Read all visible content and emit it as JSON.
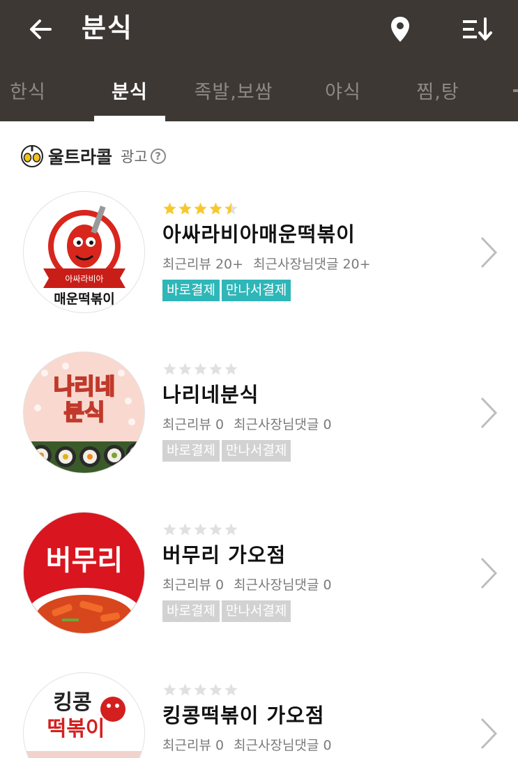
{
  "header": {
    "title": "분식",
    "tabs": [
      {
        "label": "한식",
        "active": false
      },
      {
        "label": "분식",
        "active": true
      },
      {
        "label": "족발,보쌈",
        "active": false
      },
      {
        "label": "야식",
        "active": false
      },
      {
        "label": "찜,탕",
        "active": false
      }
    ]
  },
  "ad_section": {
    "title": "울트라콜",
    "tag": "광고",
    "help": "?"
  },
  "restaurants": [
    {
      "name": "아싸라비아매운떡볶이",
      "rating": 4.5,
      "review_text": "최근리뷰 20+",
      "owner_reply_text": "최근사장님댓글 20+",
      "badges": [
        "바로결제",
        "만나서결제"
      ],
      "badges_active": true,
      "logo_text": "매운떡볶이",
      "logo_sub": "아싸라비아"
    },
    {
      "name": "나리네분식",
      "rating": 0,
      "review_text": "최근리뷰 0",
      "owner_reply_text": "최근사장님댓글 0",
      "badges": [
        "바로결제",
        "만나서결제"
      ],
      "badges_active": false,
      "logo_text": "나리네",
      "logo_sub": "분식"
    },
    {
      "name": "버무리 가오점",
      "rating": 0,
      "review_text": "최근리뷰 0",
      "owner_reply_text": "최근사장님댓글 0",
      "badges": [
        "바로결제",
        "만나서결제"
      ],
      "badges_active": false,
      "logo_text": "버무리"
    },
    {
      "name": "킹콩떡볶이 가오점",
      "rating": 0,
      "review_text": "최근리뷰 0",
      "owner_reply_text": "최근사장님댓글 0",
      "badges": [],
      "badges_active": false,
      "logo_text": "킹콩",
      "logo_sub": "떡볶이"
    }
  ],
  "colors": {
    "header_bg": "#3e3834",
    "badge_active": "#2fb6b8",
    "badge_inactive": "#d2d2d2",
    "star_filled": "#f7c82c",
    "star_empty": "#e0e0e0"
  }
}
